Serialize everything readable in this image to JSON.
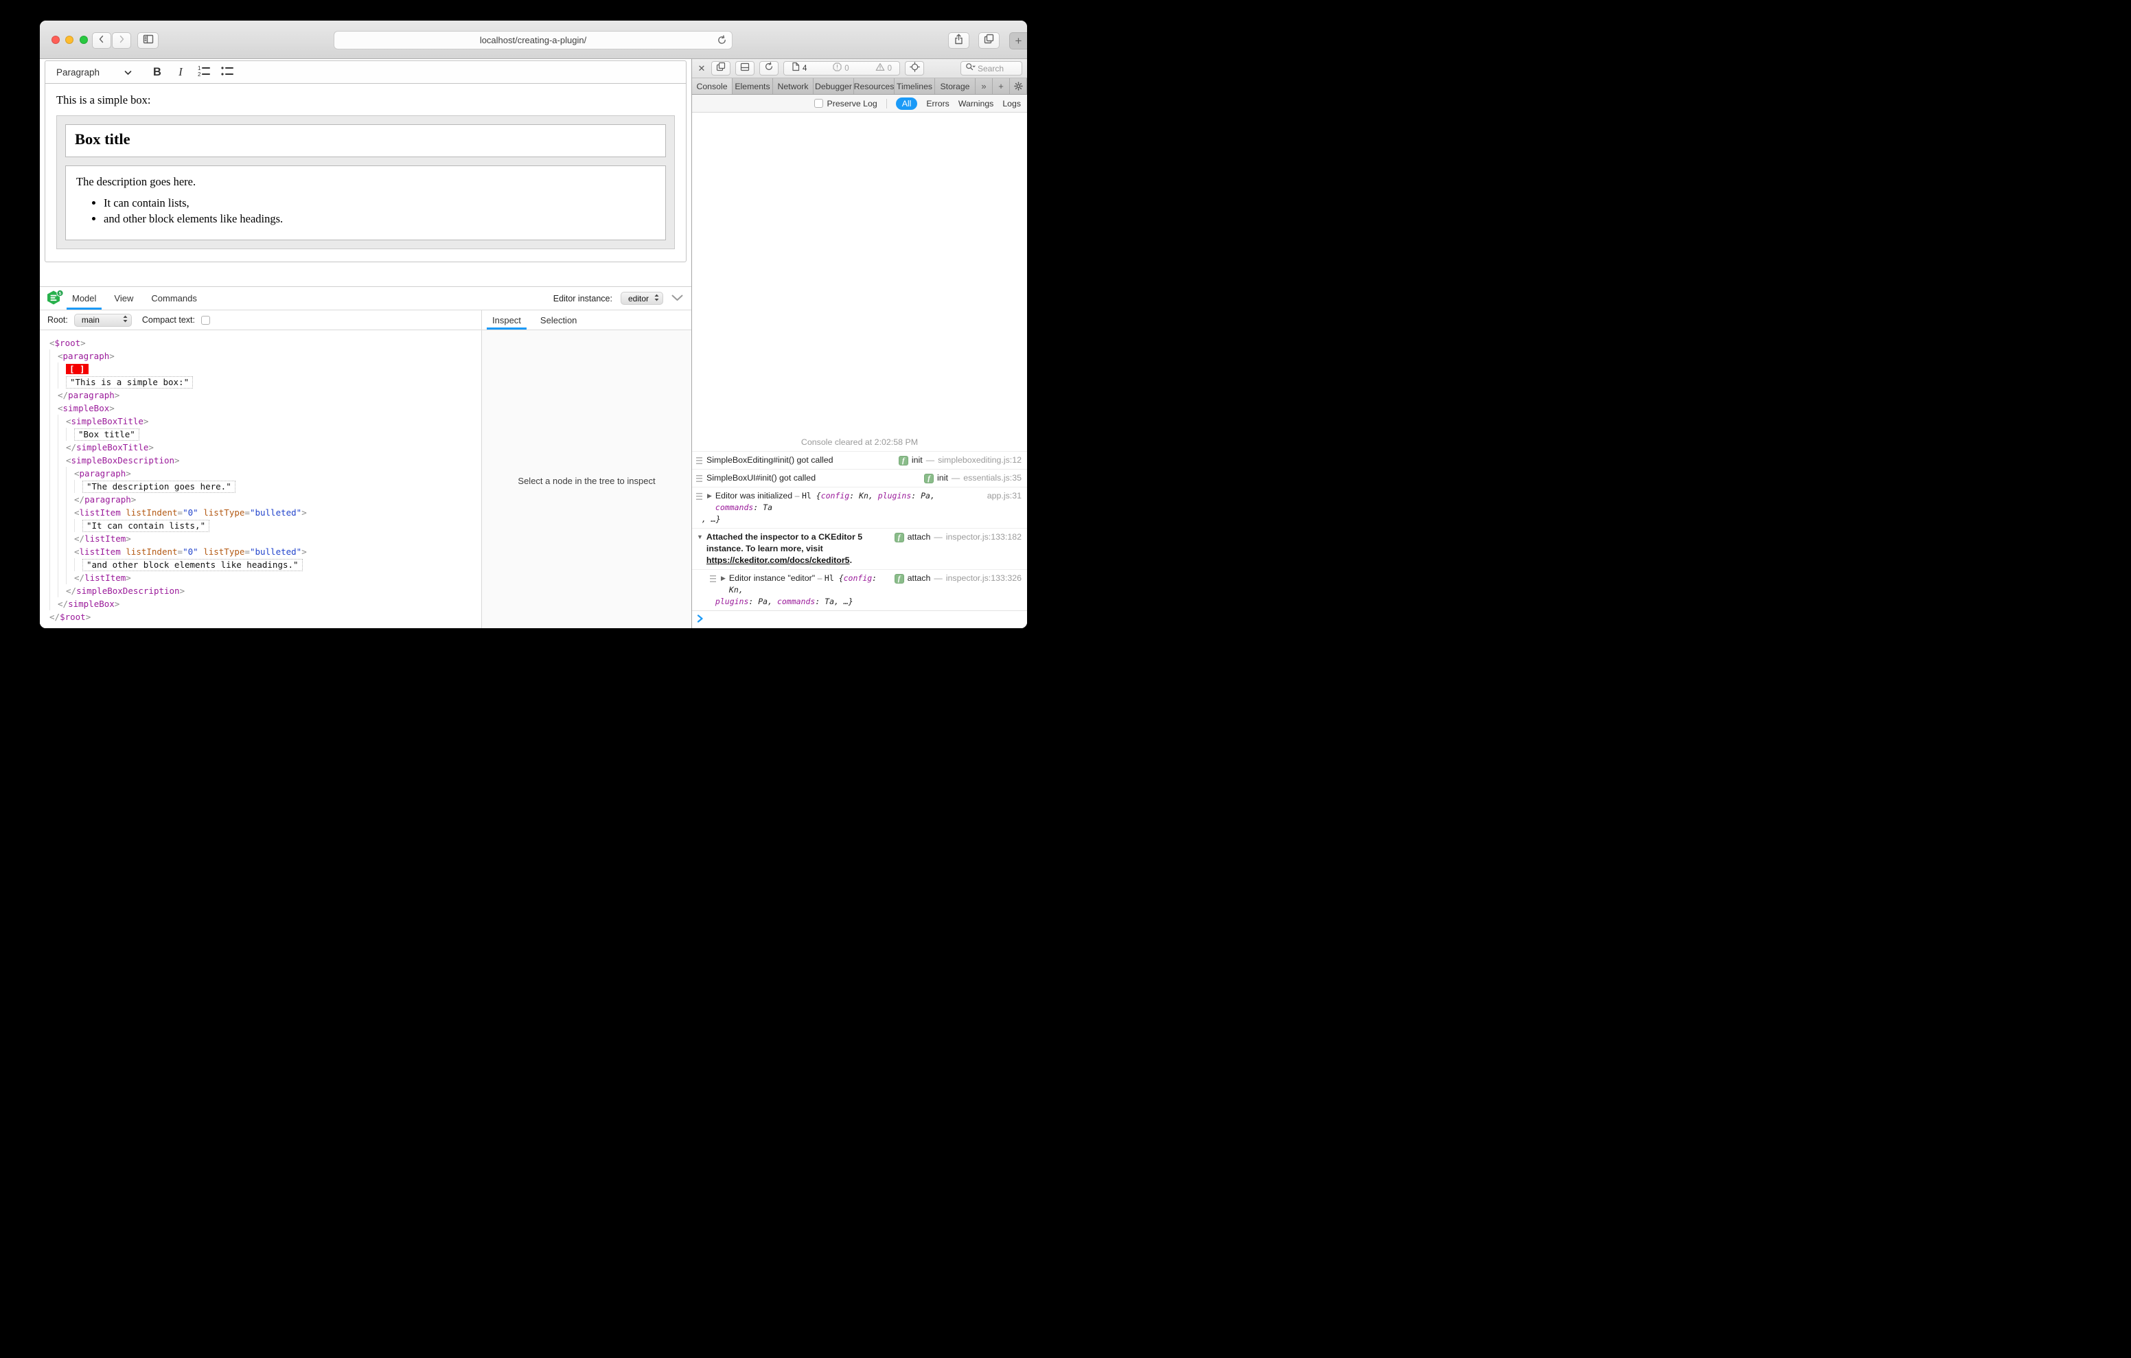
{
  "colors": {
    "accent_blue": "#1b9af7",
    "selection_red": "#f40000",
    "badge_green": "#8abc8a",
    "logo_green": "#28b14c",
    "logo_badge_green": "#1fa24a",
    "tag_purple": "#9a1a9a",
    "attr_orange": "#b35913",
    "value_blue": "#2244cc",
    "traffic_red": "#ff5f57",
    "traffic_yellow": "#febc2e",
    "traffic_green": "#28c840"
  },
  "browser": {
    "url": "localhost/creating-a-plugin/",
    "new_tab_label": "+"
  },
  "editor": {
    "toolbar": {
      "style_button": "Paragraph",
      "bold_label": "B",
      "italic_label": "I"
    },
    "doc": {
      "intro": "This is a simple box:",
      "box_title": "Box title",
      "description": "The description goes here.",
      "bullets": [
        "It can contain lists,",
        "and other block elements like headings."
      ]
    }
  },
  "inspector": {
    "logo_badge": "5",
    "tabs": [
      {
        "label": "Model",
        "active": true
      },
      {
        "label": "View",
        "active": false
      },
      {
        "label": "Commands",
        "active": false
      }
    ],
    "instance_label": "Editor instance:",
    "instance_value": "editor",
    "root_label": "Root:",
    "root_value": "main",
    "compact_label": "Compact text:",
    "panel_tabs": [
      {
        "label": "Inspect",
        "active": true
      },
      {
        "label": "Selection",
        "active": false
      }
    ],
    "empty_message": "Select a node in the tree to inspect",
    "tree": [
      {
        "indent": 0,
        "tokens": [
          [
            "br",
            "<"
          ],
          [
            "tag",
            "$root"
          ],
          [
            "br",
            ">"
          ]
        ]
      },
      {
        "indent": 1,
        "tokens": [
          [
            "br",
            "<"
          ],
          [
            "tag",
            "paragraph"
          ],
          [
            "br",
            ">"
          ]
        ]
      },
      {
        "indent": 2,
        "tokens": [
          [
            "sel",
            "[ ]"
          ]
        ]
      },
      {
        "indent": 2,
        "tokens": [
          [
            "txt",
            "\"This is a simple box:\""
          ]
        ]
      },
      {
        "indent": 1,
        "tokens": [
          [
            "br",
            "</"
          ],
          [
            "tag",
            "paragraph"
          ],
          [
            "br",
            ">"
          ]
        ]
      },
      {
        "indent": 1,
        "tokens": [
          [
            "br",
            "<"
          ],
          [
            "tag",
            "simpleBox"
          ],
          [
            "br",
            ">"
          ]
        ]
      },
      {
        "indent": 2,
        "tokens": [
          [
            "br",
            "<"
          ],
          [
            "tag",
            "simpleBoxTitle"
          ],
          [
            "br",
            ">"
          ]
        ]
      },
      {
        "indent": 3,
        "tokens": [
          [
            "txt",
            "\"Box title\""
          ]
        ]
      },
      {
        "indent": 2,
        "tokens": [
          [
            "br",
            "</"
          ],
          [
            "tag",
            "simpleBoxTitle"
          ],
          [
            "br",
            ">"
          ]
        ]
      },
      {
        "indent": 2,
        "tokens": [
          [
            "br",
            "<"
          ],
          [
            "tag",
            "simpleBoxDescription"
          ],
          [
            "br",
            ">"
          ]
        ]
      },
      {
        "indent": 3,
        "tokens": [
          [
            "br",
            "<"
          ],
          [
            "tag",
            "paragraph"
          ],
          [
            "br",
            ">"
          ]
        ]
      },
      {
        "indent": 4,
        "tokens": [
          [
            "txt",
            "\"The description goes here.\""
          ]
        ]
      },
      {
        "indent": 3,
        "tokens": [
          [
            "br",
            "</"
          ],
          [
            "tag",
            "paragraph"
          ],
          [
            "br",
            ">"
          ]
        ]
      },
      {
        "indent": 3,
        "tokens": [
          [
            "br",
            "<"
          ],
          [
            "tag",
            "listItem"
          ],
          [
            "br",
            " "
          ],
          [
            "attr",
            "listIndent"
          ],
          [
            "br",
            "="
          ],
          [
            "val",
            "\"0\""
          ],
          [
            "br",
            " "
          ],
          [
            "attr",
            "listType"
          ],
          [
            "br",
            "="
          ],
          [
            "val",
            "\"bulleted\""
          ],
          [
            "br",
            ">"
          ]
        ]
      },
      {
        "indent": 4,
        "tokens": [
          [
            "txt",
            "\"It can contain lists,\""
          ]
        ]
      },
      {
        "indent": 3,
        "tokens": [
          [
            "br",
            "</"
          ],
          [
            "tag",
            "listItem"
          ],
          [
            "br",
            ">"
          ]
        ]
      },
      {
        "indent": 3,
        "tokens": [
          [
            "br",
            "<"
          ],
          [
            "tag",
            "listItem"
          ],
          [
            "br",
            " "
          ],
          [
            "attr",
            "listIndent"
          ],
          [
            "br",
            "="
          ],
          [
            "val",
            "\"0\""
          ],
          [
            "br",
            " "
          ],
          [
            "attr",
            "listType"
          ],
          [
            "br",
            "="
          ],
          [
            "val",
            "\"bulleted\""
          ],
          [
            "br",
            ">"
          ]
        ]
      },
      {
        "indent": 4,
        "tokens": [
          [
            "txt",
            "\"and other block elements like headings.\""
          ]
        ]
      },
      {
        "indent": 3,
        "tokens": [
          [
            "br",
            "</"
          ],
          [
            "tag",
            "listItem"
          ],
          [
            "br",
            ">"
          ]
        ]
      },
      {
        "indent": 2,
        "tokens": [
          [
            "br",
            "</"
          ],
          [
            "tag",
            "simpleBoxDescription"
          ],
          [
            "br",
            ">"
          ]
        ]
      },
      {
        "indent": 1,
        "tokens": [
          [
            "br",
            "</"
          ],
          [
            "tag",
            "simpleBox"
          ],
          [
            "br",
            ">"
          ]
        ]
      },
      {
        "indent": 0,
        "tokens": [
          [
            "br",
            "</"
          ],
          [
            "tag",
            "$root"
          ],
          [
            "br",
            ">"
          ]
        ]
      }
    ]
  },
  "devtools": {
    "toolbar": {
      "page_count": "4",
      "error_count": "0",
      "warning_count": "0",
      "search_placeholder": "Search"
    },
    "tabs": [
      {
        "label": "Console",
        "active": true
      },
      {
        "label": "Elements",
        "active": false
      },
      {
        "label": "Network",
        "active": false
      },
      {
        "label": "Debugger",
        "active": false
      },
      {
        "label": "Resources",
        "active": false
      },
      {
        "label": "Timelines",
        "active": false
      },
      {
        "label": "Storage",
        "active": false
      }
    ],
    "overflow_label": "»",
    "add_label": "+",
    "filter": {
      "preserve_label": "Preserve Log",
      "scopes": [
        {
          "label": "All",
          "active": true
        },
        {
          "label": "Errors",
          "active": false
        },
        {
          "label": "Warnings",
          "active": false
        },
        {
          "label": "Logs",
          "active": false
        }
      ]
    },
    "console": {
      "cleared": "Console cleared at 2:02:58 PM",
      "messages": [
        {
          "icon": true,
          "disclosure": null,
          "nested": false,
          "lines": [
            [
              [
                "t",
                "SimpleBoxEditing#init() got called"
              ]
            ]
          ],
          "badge": "f",
          "fn": "init",
          "source": "simpleboxediting.js:12"
        },
        {
          "icon": true,
          "disclosure": null,
          "nested": false,
          "lines": [
            [
              [
                "t",
                "SimpleBoxUI#init() got called"
              ]
            ]
          ],
          "badge": "f",
          "fn": "init",
          "source": "essentials.js:35"
        },
        {
          "icon": true,
          "disclosure": "closed",
          "nested": false,
          "outdent2": true,
          "lines": [
            [
              [
                "t",
                "Editor was initialized"
              ],
              [
                "dim",
                " – "
              ],
              [
                "mono",
                "Hl "
              ],
              [
                "o",
                "{"
              ],
              [
                "on",
                "config"
              ],
              [
                "o",
                ": Kn, "
              ],
              [
                "on",
                "plugins"
              ],
              [
                "o",
                ": Pa, "
              ],
              [
                "on",
                "commands"
              ],
              [
                "o",
                ": Ta"
              ]
            ],
            [
              [
                "o",
                ", …}"
              ]
            ]
          ],
          "badge": null,
          "fn": null,
          "source": "app.js:31"
        },
        {
          "icon": false,
          "disclosure": "open",
          "nested": false,
          "lines": [
            [
              [
                "b",
                "Attached the inspector to a CKEditor 5"
              ]
            ],
            [
              [
                "b",
                "instance. To learn more, visit"
              ]
            ],
            [
              [
                "link",
                "https://ckeditor.com/docs/ckeditor5"
              ],
              [
                "b",
                "."
              ]
            ]
          ],
          "badge": "f",
          "fn": "attach",
          "source": "inspector.js:133:182"
        },
        {
          "icon": true,
          "disclosure": "closed",
          "nested": true,
          "outdent2": true,
          "lines": [
            [
              [
                "t",
                "Editor instance \"editor\""
              ],
              [
                "dim",
                " – "
              ],
              [
                "mono",
                "Hl "
              ],
              [
                "o",
                "{"
              ],
              [
                "on",
                "config"
              ],
              [
                "o",
                ": Kn,"
              ]
            ],
            [
              [
                "on",
                "plugins"
              ],
              [
                "o",
                ": Pa, "
              ],
              [
                "on",
                "commands"
              ],
              [
                "o",
                ": Ta, …}"
              ]
            ]
          ],
          "badge": "f",
          "fn": "attach",
          "source": "inspector.js:133:326"
        }
      ]
    }
  }
}
